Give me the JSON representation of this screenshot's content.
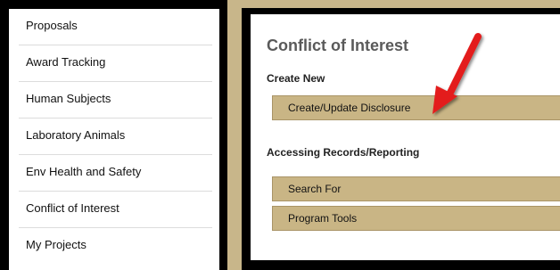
{
  "sidebar": {
    "items": [
      {
        "label": "Proposals"
      },
      {
        "label": "Award Tracking"
      },
      {
        "label": "Human Subjects"
      },
      {
        "label": "Laboratory Animals"
      },
      {
        "label": "Env Health and Safety"
      },
      {
        "label": "Conflict of Interest"
      },
      {
        "label": "My Projects"
      }
    ]
  },
  "main": {
    "title": "Conflict of Interest",
    "create_heading": "Create New",
    "create_button": "Create/Update Disclosure",
    "access_heading": "Accessing Records/Reporting",
    "search_button": "Search For",
    "program_button": "Program Tools"
  },
  "colors": {
    "page_background": "#c8b68a",
    "button_fill": "#c9b585",
    "frame": "#000000",
    "arrow": "#e31b1b"
  }
}
